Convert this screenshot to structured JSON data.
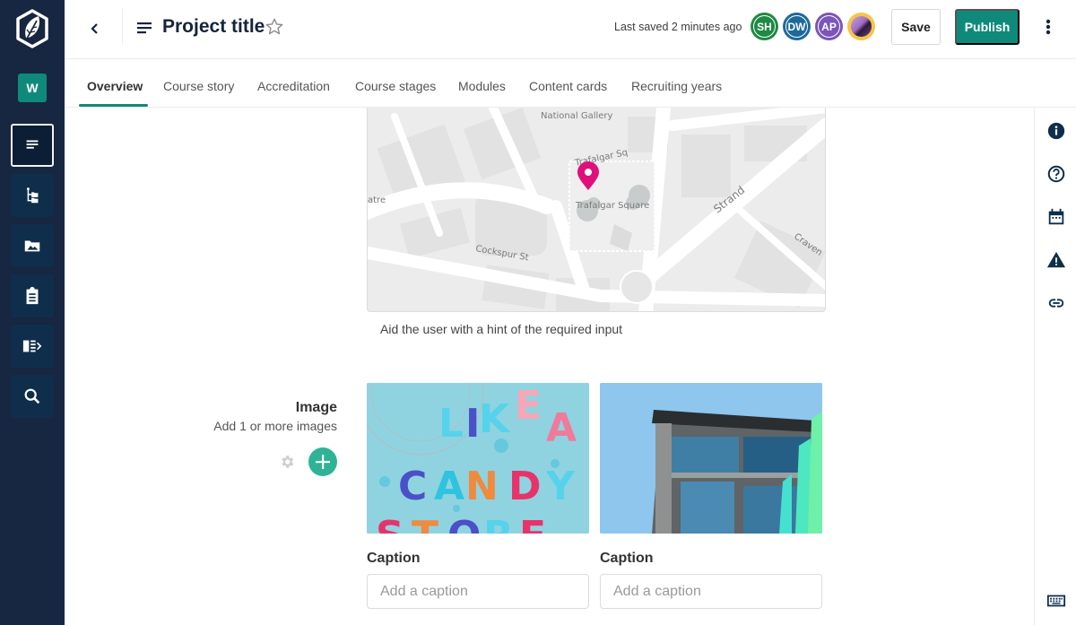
{
  "app": {
    "workspace_initial": "W"
  },
  "header": {
    "title": "Project title",
    "last_saved": "Last saved 2 minutes ago",
    "save_label": "Save",
    "publish_label": "Publish",
    "collaborators": [
      {
        "initials": "SH",
        "color": "#1e8a45"
      },
      {
        "initials": "DW",
        "color": "#1d6a9a"
      },
      {
        "initials": "AP",
        "color": "#7b55b8"
      },
      {
        "initials": "",
        "color": "#f4c54b",
        "type": "photo"
      }
    ]
  },
  "sidebar": {
    "items": [
      {
        "icon": "document-lines-icon",
        "label": "Overview",
        "active": true
      },
      {
        "icon": "folder-tree-icon",
        "label": "Structure"
      },
      {
        "icon": "image-folder-icon",
        "label": "Media"
      },
      {
        "icon": "clipboard-icon",
        "label": "Assessments"
      },
      {
        "icon": "list-expand-icon",
        "label": "Panels"
      },
      {
        "icon": "search-icon",
        "label": "Search"
      }
    ]
  },
  "tabs": [
    {
      "label": "Overview",
      "active": true
    },
    {
      "label": "Course story"
    },
    {
      "label": "Accreditation"
    },
    {
      "label": "Course stages"
    },
    {
      "label": "Modules"
    },
    {
      "label": "Content cards"
    },
    {
      "label": "Recruiting years"
    }
  ],
  "right_rail": {
    "icons": [
      "info-icon",
      "help-icon",
      "calendar-icon",
      "warning-icon",
      "link-icon",
      "keyboard-icon"
    ]
  },
  "map": {
    "labels": {
      "national_gallery": "National Gallery",
      "trafalgar_sq": "Trafalgar Sq",
      "trafalgar_square": "Trafalgar Square",
      "strand": "Strand",
      "cockspur": "Cockspur St",
      "theatre": "atre",
      "craven": "Craven"
    },
    "pin_color": "#e0107a",
    "hint": "Aid the user with a hint of the required input"
  },
  "image_field": {
    "label": "Image",
    "sublabel": "Add 1 or more images",
    "images": [
      {
        "alt": "Candy store cookies",
        "caption_label": "Caption",
        "caption_placeholder": "Add a caption",
        "caption_value": ""
      },
      {
        "alt": "Modern building",
        "caption_label": "Caption",
        "caption_placeholder": "Add a caption",
        "caption_value": ""
      }
    ]
  }
}
